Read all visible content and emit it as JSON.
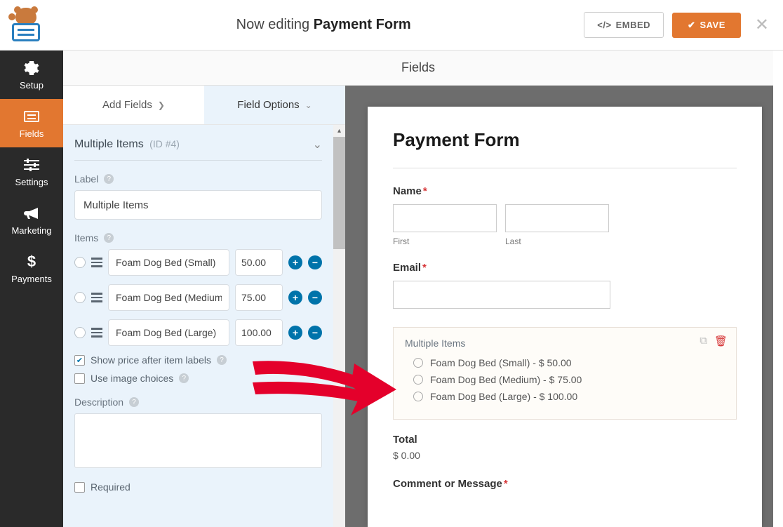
{
  "header": {
    "editing_prefix": "Now editing ",
    "form_name": "Payment Form",
    "embed_label": "EMBED",
    "save_label": "SAVE"
  },
  "sidebar": {
    "items": [
      {
        "label": "Setup"
      },
      {
        "label": "Fields"
      },
      {
        "label": "Settings"
      },
      {
        "label": "Marketing"
      },
      {
        "label": "Payments"
      }
    ]
  },
  "fields_header": "Fields",
  "tabs": {
    "add_fields": "Add Fields",
    "field_options": "Field Options"
  },
  "field_options": {
    "section_title": "Multiple Items",
    "id_text": "(ID #4)",
    "label_label": "Label",
    "label_value": "Multiple Items",
    "items_label": "Items",
    "items": [
      {
        "name": "Foam Dog Bed (Small)",
        "price": "50.00"
      },
      {
        "name": "Foam Dog Bed (Medium)",
        "price": "75.00"
      },
      {
        "name": "Foam Dog Bed (Large)",
        "price": "100.00"
      }
    ],
    "show_price_label": "Show price after item labels",
    "use_image_label": "Use image choices",
    "description_label": "Description",
    "required_label": "Required"
  },
  "preview": {
    "title": "Payment Form",
    "name_label": "Name",
    "first_sub": "First",
    "last_sub": "Last",
    "email_label": "Email",
    "multi_label": "Multiple Items",
    "options": [
      "Foam Dog Bed (Small) - $ 50.00",
      "Foam Dog Bed (Medium) - $ 75.00",
      "Foam Dog Bed (Large) - $ 100.00"
    ],
    "total_label": "Total",
    "total_value": "$ 0.00",
    "comment_label": "Comment or Message"
  }
}
